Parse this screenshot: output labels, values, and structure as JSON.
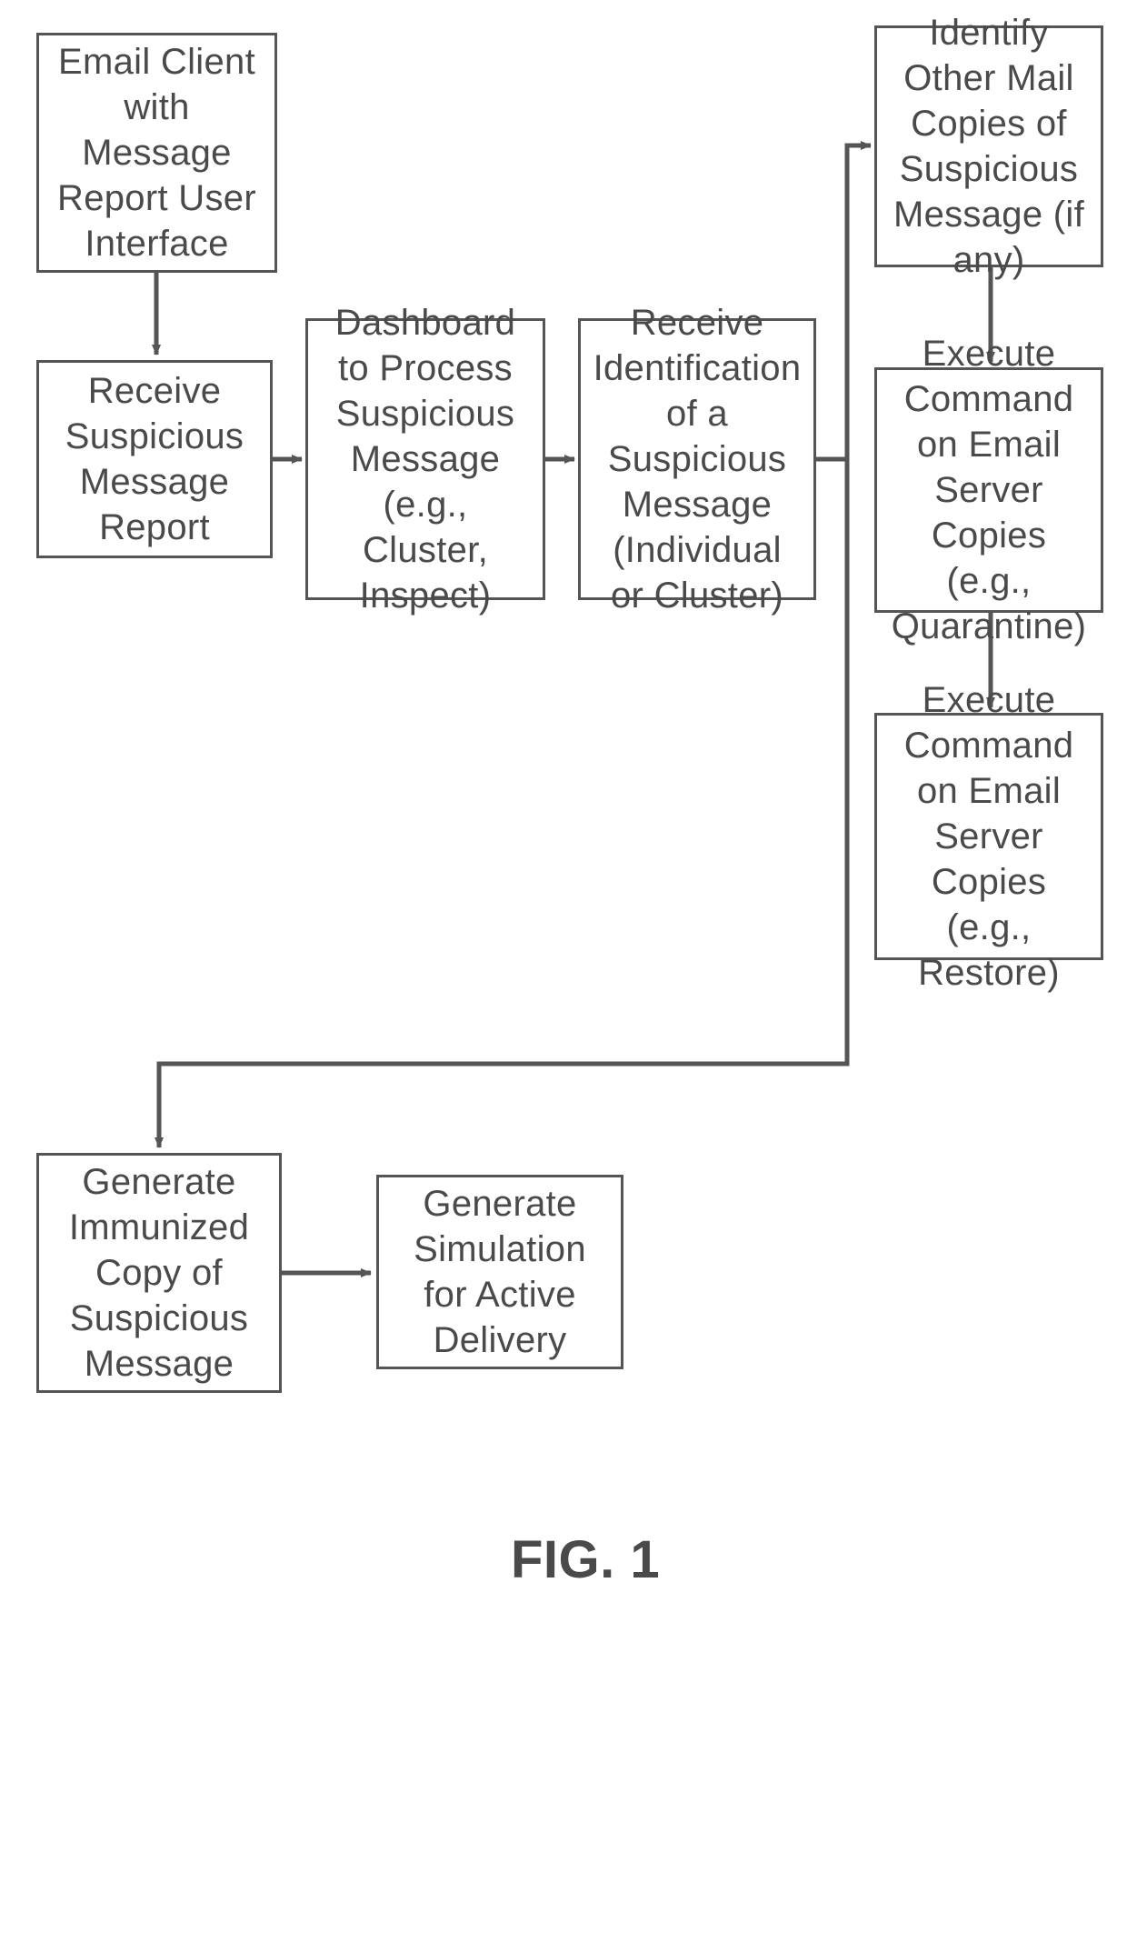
{
  "boxes": {
    "b1": "Email Client with Message Report User Interface",
    "b2": "Receive Suspicious Message Report",
    "b3": "Dashboard to Process Suspicious Message (e.g., Cluster, Inspect)",
    "b4": "Receive Identification of a Suspicious Message (Individual or Cluster)",
    "b5": "Identify Other Mail Copies of Suspicious Message (if any)",
    "b6": "Execute Command on Email Server Copies (e.g., Quarantine)",
    "b7": "Execute Command on Email Server Copies (e.g., Restore)",
    "b8": "Generate Immunized Copy of Suspicious Message",
    "b9": "Generate Simulation for Active Delivery"
  },
  "caption": "FIG. 1"
}
